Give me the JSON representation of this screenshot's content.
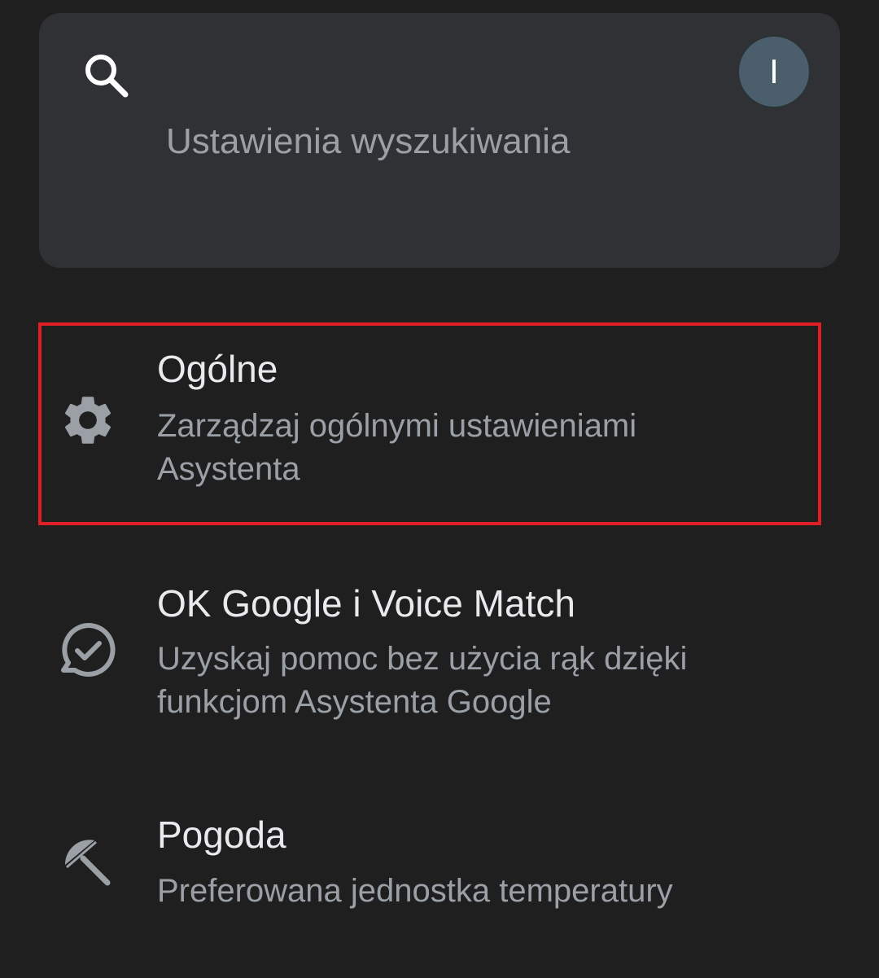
{
  "search": {
    "placeholder": "Ustawienia wyszukiwania",
    "icon": "search-icon"
  },
  "account": {
    "avatar_letter": "I",
    "avatar_color": "#4a5f6b"
  },
  "settings": {
    "items": [
      {
        "icon": "gear-icon",
        "title": "Ogólne",
        "subtitle": "Zarządzaj ogólnymi ustawieniami Asystenta",
        "highlighted": true
      },
      {
        "icon": "voice-match-icon",
        "title": "OK Google i Voice Match",
        "subtitle": "Uzyskaj pomoc bez użycia rąk dzięki funkcjom Asystenta Google",
        "highlighted": false
      },
      {
        "icon": "umbrella-icon",
        "title": "Pogoda",
        "subtitle": "Preferowana jednostka temperatury",
        "highlighted": false
      }
    ]
  },
  "colors": {
    "background": "#1f1f1f",
    "card": "#303134",
    "text_primary": "#e8eaed",
    "text_secondary": "#9aa0a6",
    "highlight_border": "#e01e25"
  }
}
